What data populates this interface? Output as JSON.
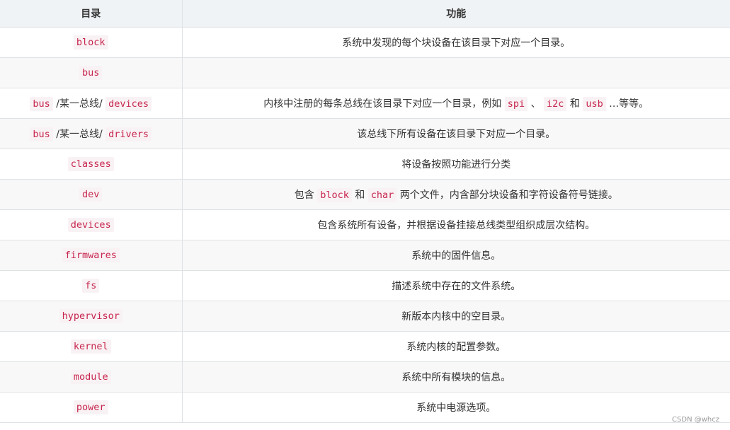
{
  "table": {
    "headers": [
      "目录",
      "功能"
    ],
    "rows": [
      {
        "dir": [
          {
            "code": "block"
          }
        ],
        "desc": [
          {
            "text": "系统中发现的每个块设备在该目录下对应一个目录。"
          }
        ]
      },
      {
        "dir": [
          {
            "code": "bus"
          }
        ],
        "desc": []
      },
      {
        "dir": [
          {
            "code": "bus"
          },
          {
            "text": " /某一总线/ "
          },
          {
            "code": "devices"
          }
        ],
        "desc": [
          {
            "text": "内核中注册的每条总线在该目录下对应一个目录，例如 "
          },
          {
            "code": "spi"
          },
          {
            "text": " 、 "
          },
          {
            "code": "i2c"
          },
          {
            "text": " 和 "
          },
          {
            "code": "usb"
          },
          {
            "text": " …等等。"
          }
        ]
      },
      {
        "dir": [
          {
            "code": "bus"
          },
          {
            "text": " /某一总线/ "
          },
          {
            "code": "drivers"
          }
        ],
        "desc": [
          {
            "text": "该总线下所有设备在该目录下对应一个目录。"
          }
        ]
      },
      {
        "dir": [
          {
            "code": "classes"
          }
        ],
        "desc": [
          {
            "text": "将设备按照功能进行分类"
          }
        ]
      },
      {
        "dir": [
          {
            "code": "dev"
          }
        ],
        "desc": [
          {
            "text": "包含 "
          },
          {
            "code": "block"
          },
          {
            "text": " 和 "
          },
          {
            "code": "char"
          },
          {
            "text": " 两个文件，内含部分块设备和字符设备符号链接。"
          }
        ]
      },
      {
        "dir": [
          {
            "code": "devices"
          }
        ],
        "desc": [
          {
            "text": "包含系统所有设备，并根据设备挂接总线类型组织成层次结构。"
          }
        ]
      },
      {
        "dir": [
          {
            "code": "firmwares"
          }
        ],
        "desc": [
          {
            "text": "系统中的固件信息。"
          }
        ]
      },
      {
        "dir": [
          {
            "code": "fs"
          }
        ],
        "desc": [
          {
            "text": "描述系统中存在的文件系统。"
          }
        ]
      },
      {
        "dir": [
          {
            "code": "hypervisor"
          }
        ],
        "desc": [
          {
            "text": "新版本内核中的空目录。"
          }
        ]
      },
      {
        "dir": [
          {
            "code": "kernel"
          }
        ],
        "desc": [
          {
            "text": "系统内核的配置参数。"
          }
        ]
      },
      {
        "dir": [
          {
            "code": "module"
          }
        ],
        "desc": [
          {
            "text": "系统中所有模块的信息。"
          }
        ]
      },
      {
        "dir": [
          {
            "code": "power"
          }
        ],
        "desc": [
          {
            "text": "系统中电源选项。"
          }
        ]
      }
    ]
  },
  "watermark": "CSDN @whcz",
  "colors": {
    "header_bg": "#eff3f5",
    "stripe_bg": "#f8f8f8",
    "border": "#dfe2e5",
    "code_fg": "#c7254e",
    "code_bg": "#f9f2f4"
  }
}
